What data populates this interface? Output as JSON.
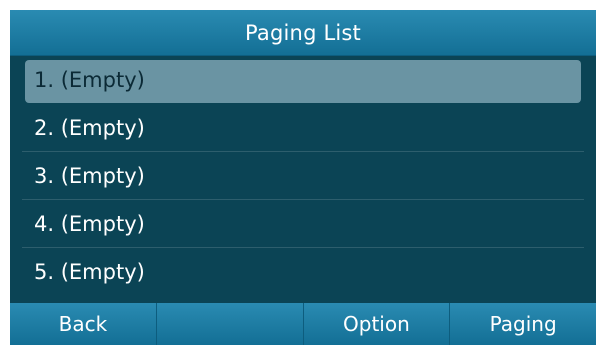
{
  "title": "Paging List",
  "items": [
    {
      "label": "1. (Empty)",
      "selected": true
    },
    {
      "label": "2. (Empty)",
      "selected": false
    },
    {
      "label": "3. (Empty)",
      "selected": false
    },
    {
      "label": "4. (Empty)",
      "selected": false
    },
    {
      "label": "5. (Empty)",
      "selected": false
    }
  ],
  "softkeys": [
    "Back",
    "",
    "Option",
    "Paging"
  ],
  "colors": {
    "screen_background": "#0b4455",
    "title_bar": "#2a8bb2",
    "selected_row": "#6a94a3",
    "text": "#ffffff"
  }
}
